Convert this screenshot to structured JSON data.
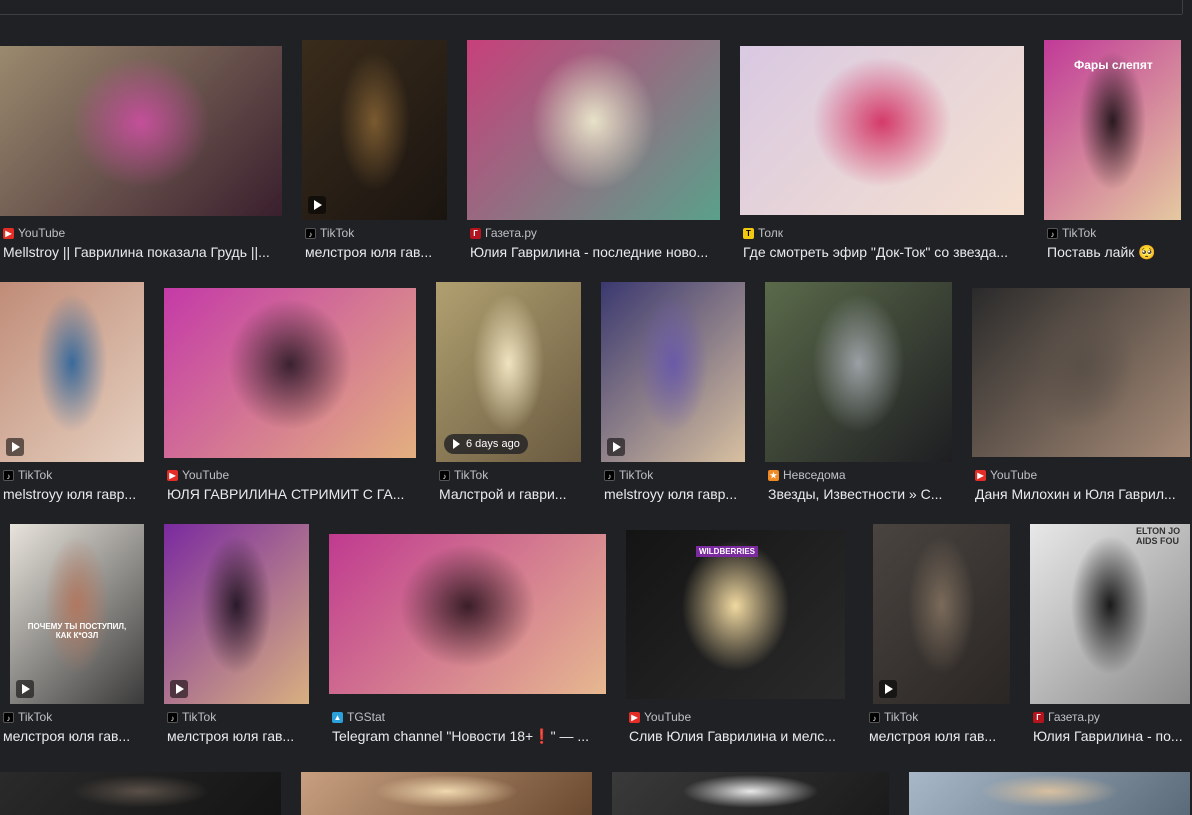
{
  "rows": [
    {
      "items": [
        {
          "source": "YouTube",
          "src_icon": "youtube-icon",
          "title": "Mellstroy || Гаврилина показала Грудь ||...",
          "colors": [
            "#9a8a6e",
            "#c44f9a",
            "#3a1f2d"
          ]
        },
        {
          "source": "TikTok",
          "src_icon": "tiktok-icon",
          "title": "мелстроя юля гав...",
          "colors": [
            "#3a2c1c",
            "#7a5a30",
            "#1a1410"
          ],
          "play": true
        },
        {
          "source": "Газета.ру",
          "src_icon": "gazeta-icon",
          "title": "Юлия Гаврилина - последние ново...",
          "colors": [
            "#c7407a",
            "#e8e2c8",
            "#5aa08a"
          ]
        },
        {
          "source": "Толк",
          "src_icon": "tolk-icon",
          "title": "Где смотреть эфир \"Док-Ток\" со звезда...",
          "colors": [
            "#d9c9e2",
            "#d43a6a",
            "#f5e0d0"
          ]
        },
        {
          "source": "TikTok",
          "src_icon": "tiktok-icon",
          "title": "Поставь лайк 🥺",
          "colors": [
            "#c13a98",
            "#2a1a20",
            "#e5c9a0"
          ],
          "overlay": "Фары слепят"
        }
      ]
    },
    {
      "items": [
        {
          "source": "TikTok",
          "src_icon": "tiktok-icon",
          "title": "melstroyy юля гавр...",
          "colors": [
            "#c08c78",
            "#3a6a9a",
            "#e6d0c0"
          ],
          "play": true
        },
        {
          "source": "YouTube",
          "src_icon": "youtube-icon",
          "title": "ЮЛЯ ГАВРИЛИНА СТРИМИТ С ГА...",
          "colors": [
            "#c43aa8",
            "#3a2230",
            "#e3b080"
          ]
        },
        {
          "source": "TikTok",
          "src_icon": "tiktok-icon",
          "title": "Малстрой и гаври...",
          "colors": [
            "#b0a070",
            "#f0e4c0",
            "#6a5a40"
          ],
          "badge": "6 days ago"
        },
        {
          "source": "TikTok",
          "src_icon": "tiktok-icon",
          "title": "melstroyy юля гавр...",
          "colors": [
            "#3a3870",
            "#6a5aa8",
            "#d8c0a0"
          ],
          "play": true
        },
        {
          "source": "Невседома",
          "src_icon": "nevsedoma-icon",
          "title": "Звезды, Известности » С...",
          "colors": [
            "#5a6a4a",
            "#9aa0a4",
            "#1e1e22"
          ]
        },
        {
          "source": "YouTube",
          "src_icon": "youtube-icon",
          "title": "Даня Милохин и Юля Гаврил...",
          "colors": [
            "#2a2a2a",
            "#5a5048",
            "#a88c78"
          ]
        }
      ]
    },
    {
      "items": [
        {
          "source": "TikTok",
          "src_icon": "tiktok-icon",
          "title": "мелстроя юля гав...",
          "colors": [
            "#e8e4dc",
            "#b07860",
            "#3a3a3a"
          ],
          "play": true,
          "overlay": "ПОЧЕМУ ТЫ ПОСТУПИЛ, КАК К*ОЗЛ"
        },
        {
          "source": "TikTok",
          "src_icon": "tiktok-icon",
          "title": "мелстроя юля гав...",
          "colors": [
            "#7a2aa0",
            "#2a1a2a",
            "#d8b080"
          ],
          "play": true
        },
        {
          "source": "TGStat",
          "src_icon": "tgstat-icon",
          "title": "Telegram channel \"Новости 18+❗\" — ...",
          "colors": [
            "#c03a90",
            "#3a1e28",
            "#e6b890"
          ]
        },
        {
          "source": "YouTube",
          "src_icon": "youtube-icon",
          "title": "Слив Юлия Гаврилина и мелс...",
          "colors": [
            "#141414",
            "#f0d8a0",
            "#2a2a2a"
          ],
          "overlay": "WILDBERRIES"
        },
        {
          "source": "TikTok",
          "src_icon": "tiktok-icon",
          "title": "мелстроя юля гав...",
          "colors": [
            "#4a4440",
            "#7a6a5a",
            "#2a2624"
          ],
          "play": true
        },
        {
          "source": "Газета.ру",
          "src_icon": "gazeta-icon",
          "title": "Юлия Гаврилина - по...",
          "colors": [
            "#e8e8e8",
            "#1a1a1a",
            "#8a8a8a"
          ],
          "overlay": "ELTON JO AIDS FOU"
        }
      ]
    },
    {
      "items": [
        {
          "colors": [
            "#2a2a2a",
            "#5a5048",
            "#141414"
          ]
        },
        {
          "colors": [
            "#c8a080",
            "#f0d8b0",
            "#6a4a30"
          ]
        },
        {
          "colors": [
            "#3a3a3a",
            "#e8e8e8",
            "#1a1a1a"
          ]
        },
        {
          "colors": [
            "#a8b8c8",
            "#d8c0a0",
            "#5a6a78"
          ]
        }
      ]
    }
  ]
}
